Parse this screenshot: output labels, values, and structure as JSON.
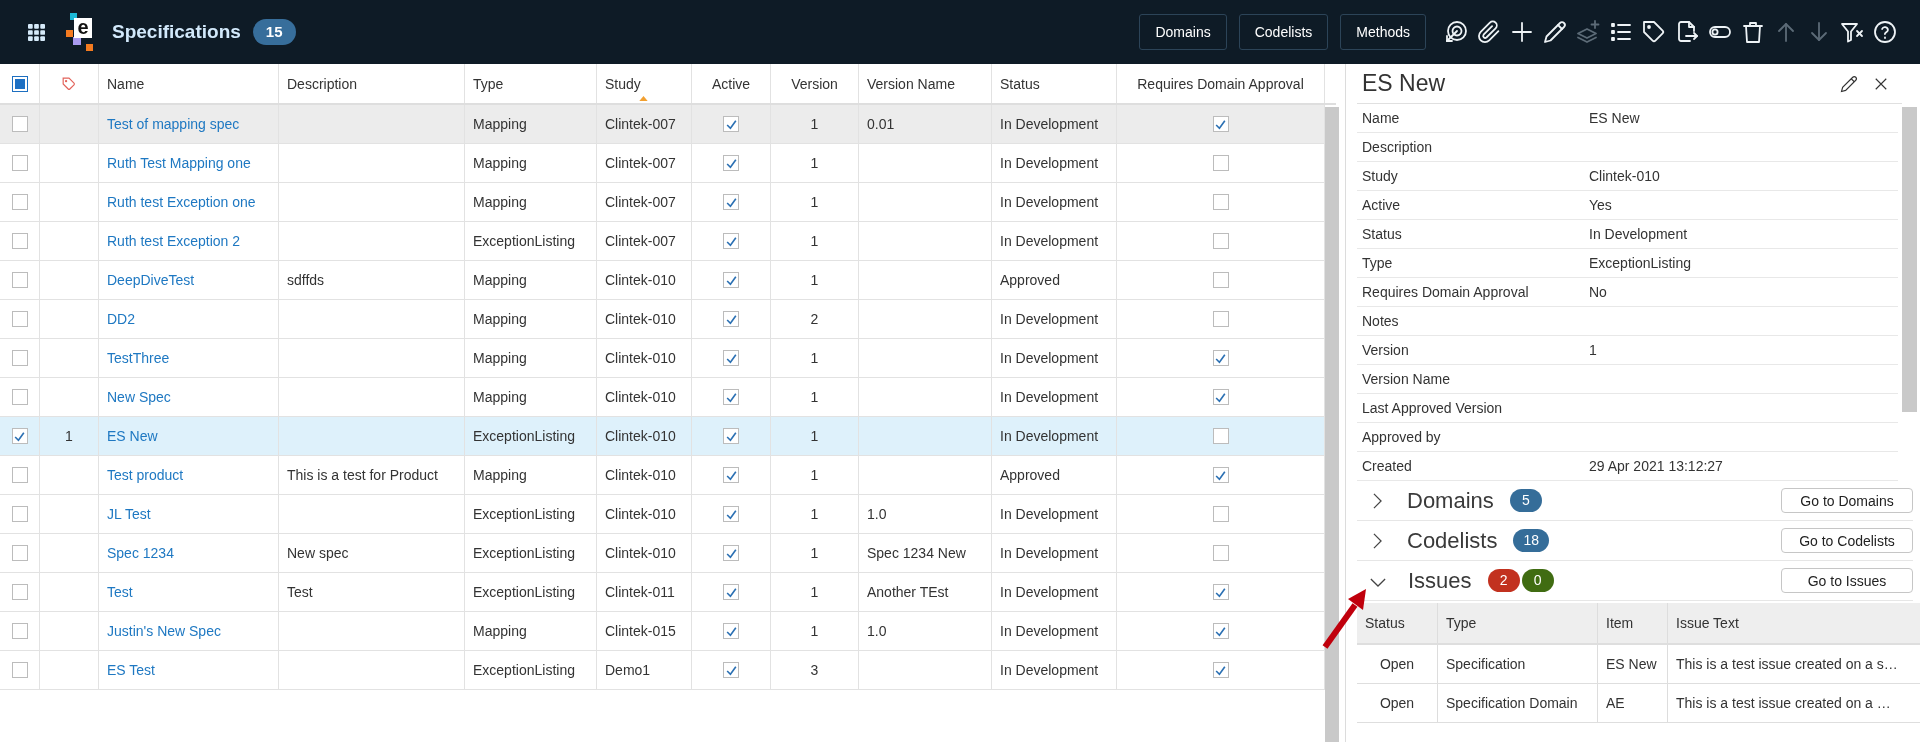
{
  "top_bar": {
    "logo_letter": "e",
    "title": "Specifications",
    "count": "15",
    "buttons": [
      {
        "label": "Domains"
      },
      {
        "label": "Codelists"
      },
      {
        "label": "Methods"
      }
    ],
    "tools": [
      {
        "kind": "target",
        "disabled": false
      },
      {
        "kind": "attach",
        "disabled": false
      },
      {
        "kind": "add",
        "disabled": false
      },
      {
        "kind": "edit",
        "disabled": false
      },
      {
        "kind": "layers_add",
        "disabled": true
      },
      {
        "kind": "list",
        "disabled": false
      },
      {
        "kind": "tag",
        "disabled": false
      },
      {
        "kind": "export",
        "disabled": false
      },
      {
        "kind": "toggle",
        "disabled": false
      },
      {
        "kind": "delete",
        "disabled": false
      },
      {
        "kind": "move_up",
        "disabled": true
      },
      {
        "kind": "move_down",
        "disabled": true
      },
      {
        "kind": "filter",
        "disabled": false
      },
      {
        "kind": "help",
        "disabled": false
      }
    ]
  },
  "table": {
    "select_all": {
      "checked": false,
      "indeterminate": true
    },
    "columns": [
      {
        "label": "Name",
        "sorted": false
      },
      {
        "label": "Description",
        "sorted": false
      },
      {
        "label": "Type",
        "sorted": false
      },
      {
        "label": "Study",
        "sorted": true
      },
      {
        "label": "Active",
        "sorted": false
      },
      {
        "label": "Version",
        "sorted": false
      },
      {
        "label": "Version Name",
        "sorted": false
      },
      {
        "label": "Status",
        "sorted": false
      },
      {
        "label": "Requires Domain Approval",
        "sorted": false
      }
    ],
    "rows": [
      {
        "selected": false,
        "hovered": true,
        "name": "Test of mapping spec",
        "type": "Mapping",
        "study": "Clintek-007",
        "active": true,
        "version": "1",
        "version_name": "0.01",
        "status": "In Development",
        "requires_domain_approval": true
      },
      {
        "selected": false,
        "hovered": false,
        "name": "Ruth Test Mapping one",
        "type": "Mapping",
        "study": "Clintek-007",
        "active": true,
        "version": "1",
        "status": "In Development",
        "requires_domain_approval": false
      },
      {
        "selected": false,
        "hovered": false,
        "name": "Ruth test Exception one",
        "type": "Mapping",
        "study": "Clintek-007",
        "active": true,
        "version": "1",
        "status": "In Development",
        "requires_domain_approval": false
      },
      {
        "selected": false,
        "hovered": false,
        "name": "Ruth test Exception 2",
        "type": "ExceptionListing",
        "study": "Clintek-007",
        "active": true,
        "version": "1",
        "status": "In Development",
        "requires_domain_approval": false
      },
      {
        "selected": false,
        "hovered": false,
        "name": "DeepDiveTest",
        "description": "sdffds",
        "type": "Mapping",
        "study": "Clintek-010",
        "active": true,
        "version": "1",
        "status": "Approved",
        "requires_domain_approval": false
      },
      {
        "selected": false,
        "hovered": false,
        "name": "DD2",
        "type": "Mapping",
        "study": "Clintek-010",
        "active": true,
        "version": "2",
        "status": "In Development",
        "requires_domain_approval": false
      },
      {
        "selected": false,
        "hovered": false,
        "name": "TestThree",
        "type": "Mapping",
        "study": "Clintek-010",
        "active": true,
        "version": "1",
        "status": "In Development",
        "requires_domain_approval": true
      },
      {
        "selected": false,
        "hovered": false,
        "name": "New Spec",
        "type": "Mapping",
        "study": "Clintek-010",
        "active": true,
        "version": "1",
        "status": "In Development",
        "requires_domain_approval": true
      },
      {
        "selected": true,
        "hovered": false,
        "column_2": "1",
        "name": "ES New",
        "type": "ExceptionListing",
        "study": "Clintek-010",
        "active": true,
        "version": "1",
        "status": "In Development",
        "requires_domain_approval": false
      },
      {
        "selected": false,
        "hovered": false,
        "name": "Test product",
        "description": "This is a test for Product",
        "type": "Mapping",
        "study": "Clintek-010",
        "active": true,
        "version": "1",
        "status": "Approved",
        "requires_domain_approval": true
      },
      {
        "selected": false,
        "hovered": false,
        "name": "JL Test",
        "type": "ExceptionListing",
        "study": "Clintek-010",
        "active": true,
        "version": "1",
        "version_name": "1.0",
        "status": "In Development",
        "requires_domain_approval": false
      },
      {
        "selected": false,
        "hovered": false,
        "name": "Spec 1234",
        "description": "New spec",
        "type": "ExceptionListing",
        "study": "Clintek-010",
        "active": true,
        "version": "1",
        "version_name": "Spec 1234 New",
        "status": "In Development",
        "requires_domain_approval": false
      },
      {
        "selected": false,
        "hovered": false,
        "name": "Test",
        "description": "Test",
        "type": "ExceptionListing",
        "study": "Clintek-011",
        "active": true,
        "version": "1",
        "version_name": "Another TEst",
        "status": "In Development",
        "requires_domain_approval": true
      },
      {
        "selected": false,
        "hovered": false,
        "name": "Justin's New Spec",
        "type": "Mapping",
        "study": "Clintek-015",
        "active": true,
        "version": "1",
        "version_name": "1.0",
        "status": "In Development",
        "requires_domain_approval": true
      },
      {
        "selected": false,
        "hovered": false,
        "name": "ES Test",
        "type": "ExceptionListing",
        "study": "Demo1",
        "active": true,
        "version": "3",
        "status": "In Development",
        "requires_domain_approval": true
      }
    ]
  },
  "details": {
    "title": "ES New",
    "fields": [
      {
        "label": "Name",
        "value": "ES New"
      },
      {
        "label": "Description"
      },
      {
        "label": "Study",
        "value": "Clintek-010"
      },
      {
        "label": "Active",
        "value": "Yes"
      },
      {
        "label": "Status",
        "value": "In Development"
      },
      {
        "label": "Type",
        "value": "ExceptionListing"
      },
      {
        "label": "Requires Domain Approval",
        "value": "No"
      },
      {
        "label": "Notes"
      },
      {
        "label": "Version",
        "value": "1"
      },
      {
        "label": "Version Name"
      },
      {
        "label": "Last Approved Version"
      },
      {
        "label": "Approved by"
      },
      {
        "label": "Created",
        "value": "29 Apr 2021 13:12:27"
      }
    ],
    "sections": [
      {
        "title": "Domains",
        "expanded": false,
        "badges": [
          {
            "text": "5",
            "color": "#356d99"
          }
        ],
        "button": "Go to Domains"
      },
      {
        "title": "Codelists",
        "expanded": false,
        "badges": [
          {
            "text": "18",
            "color": "#356d99"
          }
        ],
        "button": "Go to Codelists"
      },
      {
        "title": "Issues",
        "expanded": true,
        "badges": [
          {
            "text": "2",
            "color": "#c2311f"
          },
          {
            "text": "0",
            "color": "#406c12"
          }
        ],
        "button": "Go to Issues",
        "table": {
          "columns": [
            "Status",
            "Type",
            "Item",
            "Issue Text"
          ],
          "rows": [
            {
              "status": "Open",
              "type": "Specification",
              "item": "ES New",
              "issue_text": "This is a test issue created on a s…"
            },
            {
              "status": "Open",
              "type": "Specification Domain",
              "item": "AE",
              "issue_text": "This is a test issue created on a …"
            }
          ]
        }
      }
    ]
  }
}
